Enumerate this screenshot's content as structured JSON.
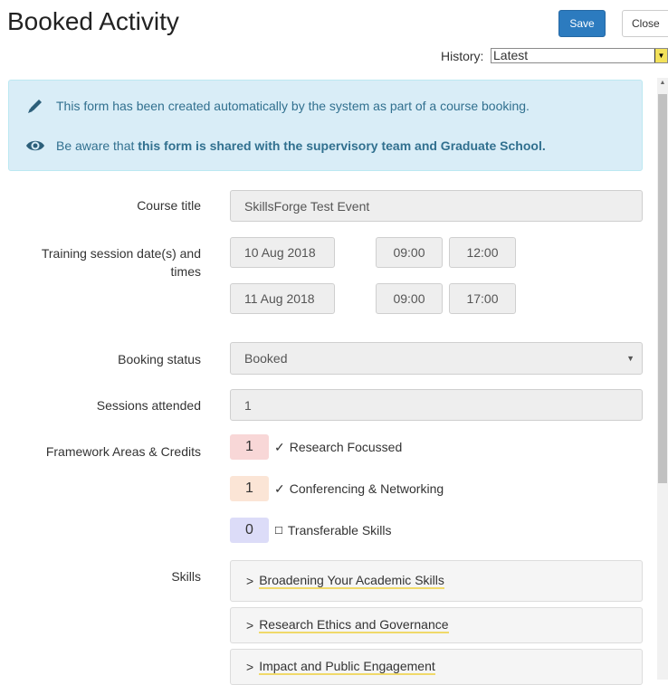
{
  "header": {
    "title": "Booked Activity",
    "save_label": "Save",
    "close_label": "Close",
    "history_label": "History:",
    "history_value": "Latest"
  },
  "info": {
    "line1": "This form has been created automatically by the system as part of a course booking.",
    "line2_prefix": "Be aware that ",
    "line2_bold": "this form is shared with the supervisory team and Graduate School."
  },
  "form": {
    "course_title_label": "Course title",
    "course_title_value": "SkillsForge Test Event",
    "sessions_label": "Training session date(s) and times",
    "sessions": [
      {
        "date": "10 Aug 2018",
        "start": "09:00",
        "end": "12:00"
      },
      {
        "date": "11 Aug 2018",
        "start": "09:00",
        "end": "17:00"
      }
    ],
    "booking_status_label": "Booking status",
    "booking_status_value": "Booked",
    "sessions_attended_label": "Sessions attended",
    "sessions_attended_value": "1",
    "framework_label": "Framework Areas & Credits",
    "framework": [
      {
        "credits": "1",
        "mark": "✓",
        "name": "Research Focussed",
        "color": "#f8d7d7"
      },
      {
        "credits": "1",
        "mark": "✓",
        "name": "Conferencing & Networking",
        "color": "#fbe5d6"
      },
      {
        "credits": "0",
        "mark": "☐",
        "name": "Transferable Skills",
        "color": "#dcdcf8"
      }
    ],
    "skills_label": "Skills",
    "skills": [
      "Broadening Your Academic Skills",
      "Research Ethics and Governance",
      "Impact and Public Engagement"
    ]
  },
  "colors": {
    "primary": "#2c7bbf",
    "info_bg": "#d9edf7",
    "info_text": "#31708f"
  }
}
